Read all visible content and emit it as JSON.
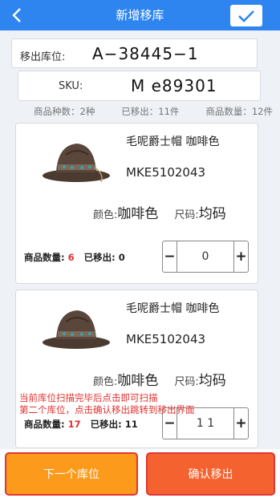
{
  "header": {
    "title": "新增移库",
    "back_icon": "chevron-left-icon",
    "confirm_icon": "check-icon"
  },
  "form": {
    "location_label": "移出库位:",
    "location_value": "A−38445−1",
    "sku_label": "SKU:",
    "sku_value": "M e89301"
  },
  "summary": {
    "kinds": "商品种数：2种",
    "moved": "已移出：11件",
    "quantity": "商品数量：12件"
  },
  "items": [
    {
      "name": "毛呢爵士帽 咖啡色",
      "code": "MKE5102043",
      "color_label": "颜色:",
      "color_value": "咖啡色",
      "size_label": "尺码:",
      "size_value": "均码",
      "qty_label": "商品数量:",
      "qty_value": "6",
      "moved_label": "已移出:",
      "moved_value": "0",
      "stepper_value": "0"
    },
    {
      "name": "毛呢爵士帽 咖啡色",
      "code": "MKE5102043",
      "color_label": "颜色:",
      "color_value": "咖啡色",
      "size_label": "尺码:",
      "size_value": "均码",
      "qty_label": "商品数量:",
      "qty_value": "17",
      "moved_label": "已移出:",
      "moved_value": "11",
      "stepper_value": "1 1"
    }
  ],
  "hint": {
    "line1": "当前库位扫描完毕后点击即可扫描",
    "line2": "第二个库位，点击确认移出跳转到移出界面"
  },
  "footer": {
    "next_label": "下一个库位",
    "confirm_label": "确认移出"
  },
  "colors": {
    "header_blue": "#2f85f0",
    "next_orange": "#fc9a1b",
    "confirm_orange": "#f4622f",
    "alert_red": "#e3302f"
  }
}
